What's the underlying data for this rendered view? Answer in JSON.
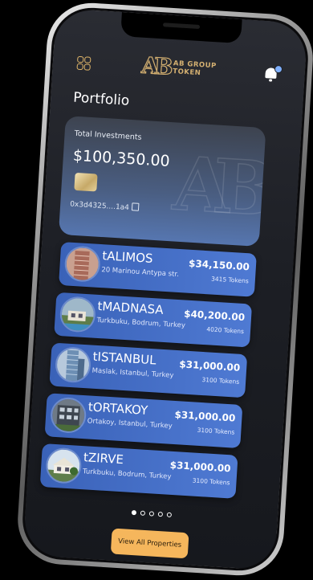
{
  "header": {
    "logo_line1": "AB GROUP",
    "logo_line2": "TOKEN"
  },
  "page_title": "Portfolio",
  "investments": {
    "label": "Total Investments",
    "value": "$100,350.00",
    "address": "0x3d4325....1a4"
  },
  "properties": [
    {
      "name": "tALIMOS",
      "location": "20 Marinou Antypa str.",
      "price": "$34,150.00",
      "tokens": "3415 Tokens",
      "thumb": "tower"
    },
    {
      "name": "tMADNASA",
      "location": "Turkbuku, Bodrum, Turkey",
      "price": "$40,200.00",
      "tokens": "4020 Tokens",
      "thumb": "villa"
    },
    {
      "name": "tISTANBUL",
      "location": "Maslak, Istanbul, Turkey",
      "price": "$31,000.00",
      "tokens": "3100 Tokens",
      "thumb": "skyscraper"
    },
    {
      "name": "tORTAKOY",
      "location": "Ortakoy, Istanbul, Turkey",
      "price": "$31,000.00",
      "tokens": "3100 Tokens",
      "thumb": "apartment"
    },
    {
      "name": "tZIRVE",
      "location": "Turkbuku, Bodrum, Turkey",
      "price": "$31,000.00",
      "tokens": "3100 Tokens",
      "thumb": "house"
    }
  ],
  "pagination": {
    "count": 5,
    "active": 0
  },
  "view_all_label": "View All Properties",
  "colors": {
    "accent_gold": "#e3b86a",
    "card_blue": "#4f7ad3",
    "button_orange": "#f5b65c"
  }
}
